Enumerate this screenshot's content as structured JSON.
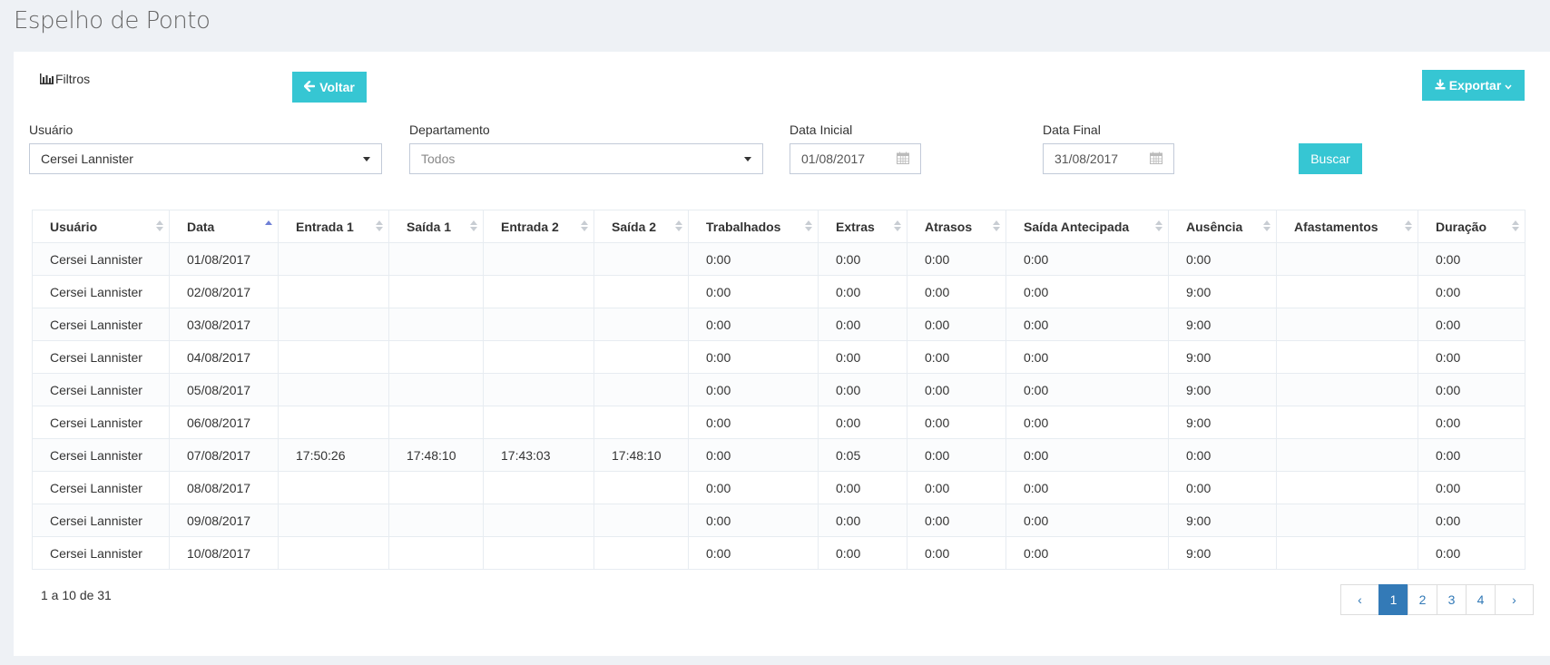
{
  "page_title": "Espelho de Ponto",
  "toolbar": {
    "filtros_label": "Filtros",
    "voltar_label": "Voltar",
    "exportar_label": "Exportar",
    "buscar_label": "Buscar"
  },
  "filters": {
    "usuario_label": "Usuário",
    "usuario_value": "Cersei Lannister",
    "departamento_label": "Departamento",
    "departamento_value": "Todos",
    "data_inicial_label": "Data Inicial",
    "data_inicial_value": "01/08/2017",
    "data_final_label": "Data Final",
    "data_final_value": "31/08/2017"
  },
  "table": {
    "columns": [
      "Usuário",
      "Data",
      "Entrada 1",
      "Saída 1",
      "Entrada 2",
      "Saída 2",
      "Trabalhados",
      "Extras",
      "Atrasos",
      "Saída Antecipada",
      "Ausência",
      "Afastamentos",
      "Duração"
    ],
    "sorted_column": "Data",
    "sort_direction": "asc",
    "rows": [
      [
        "Cersei Lannister",
        "01/08/2017",
        "",
        "",
        "",
        "",
        "0:00",
        "0:00",
        "0:00",
        "0:00",
        "0:00",
        "",
        "0:00"
      ],
      [
        "Cersei Lannister",
        "02/08/2017",
        "",
        "",
        "",
        "",
        "0:00",
        "0:00",
        "0:00",
        "0:00",
        "9:00",
        "",
        "0:00"
      ],
      [
        "Cersei Lannister",
        "03/08/2017",
        "",
        "",
        "",
        "",
        "0:00",
        "0:00",
        "0:00",
        "0:00",
        "9:00",
        "",
        "0:00"
      ],
      [
        "Cersei Lannister",
        "04/08/2017",
        "",
        "",
        "",
        "",
        "0:00",
        "0:00",
        "0:00",
        "0:00",
        "9:00",
        "",
        "0:00"
      ],
      [
        "Cersei Lannister",
        "05/08/2017",
        "",
        "",
        "",
        "",
        "0:00",
        "0:00",
        "0:00",
        "0:00",
        "9:00",
        "",
        "0:00"
      ],
      [
        "Cersei Lannister",
        "06/08/2017",
        "",
        "",
        "",
        "",
        "0:00",
        "0:00",
        "0:00",
        "0:00",
        "9:00",
        "",
        "0:00"
      ],
      [
        "Cersei Lannister",
        "07/08/2017",
        "17:50:26",
        "17:48:10",
        "17:43:03",
        "17:48:10",
        "0:00",
        "0:05",
        "0:00",
        "0:00",
        "0:00",
        "",
        "0:00"
      ],
      [
        "Cersei Lannister",
        "08/08/2017",
        "",
        "",
        "",
        "",
        "0:00",
        "0:00",
        "0:00",
        "0:00",
        "0:00",
        "",
        "0:00"
      ],
      [
        "Cersei Lannister",
        "09/08/2017",
        "",
        "",
        "",
        "",
        "0:00",
        "0:00",
        "0:00",
        "0:00",
        "9:00",
        "",
        "0:00"
      ],
      [
        "Cersei Lannister",
        "10/08/2017",
        "",
        "",
        "",
        "",
        "0:00",
        "0:00",
        "0:00",
        "0:00",
        "9:00",
        "",
        "0:00"
      ]
    ]
  },
  "footer": {
    "info": "1 a 10 de 31",
    "pages": [
      "1",
      "2",
      "3",
      "4"
    ],
    "active_page": "1",
    "prev_symbol": "‹",
    "next_symbol": "›"
  },
  "colors": {
    "accent": "#36c6d3",
    "pager_active": "#337ab7",
    "background": "#eef1f5"
  },
  "icons": {
    "filtros": "bar-chart-icon",
    "voltar": "arrow-left-icon",
    "exportar": "download-icon",
    "exportar_caret": "chevron-down-icon",
    "select_caret": "caret-down-icon",
    "date": "calendar-icon"
  }
}
